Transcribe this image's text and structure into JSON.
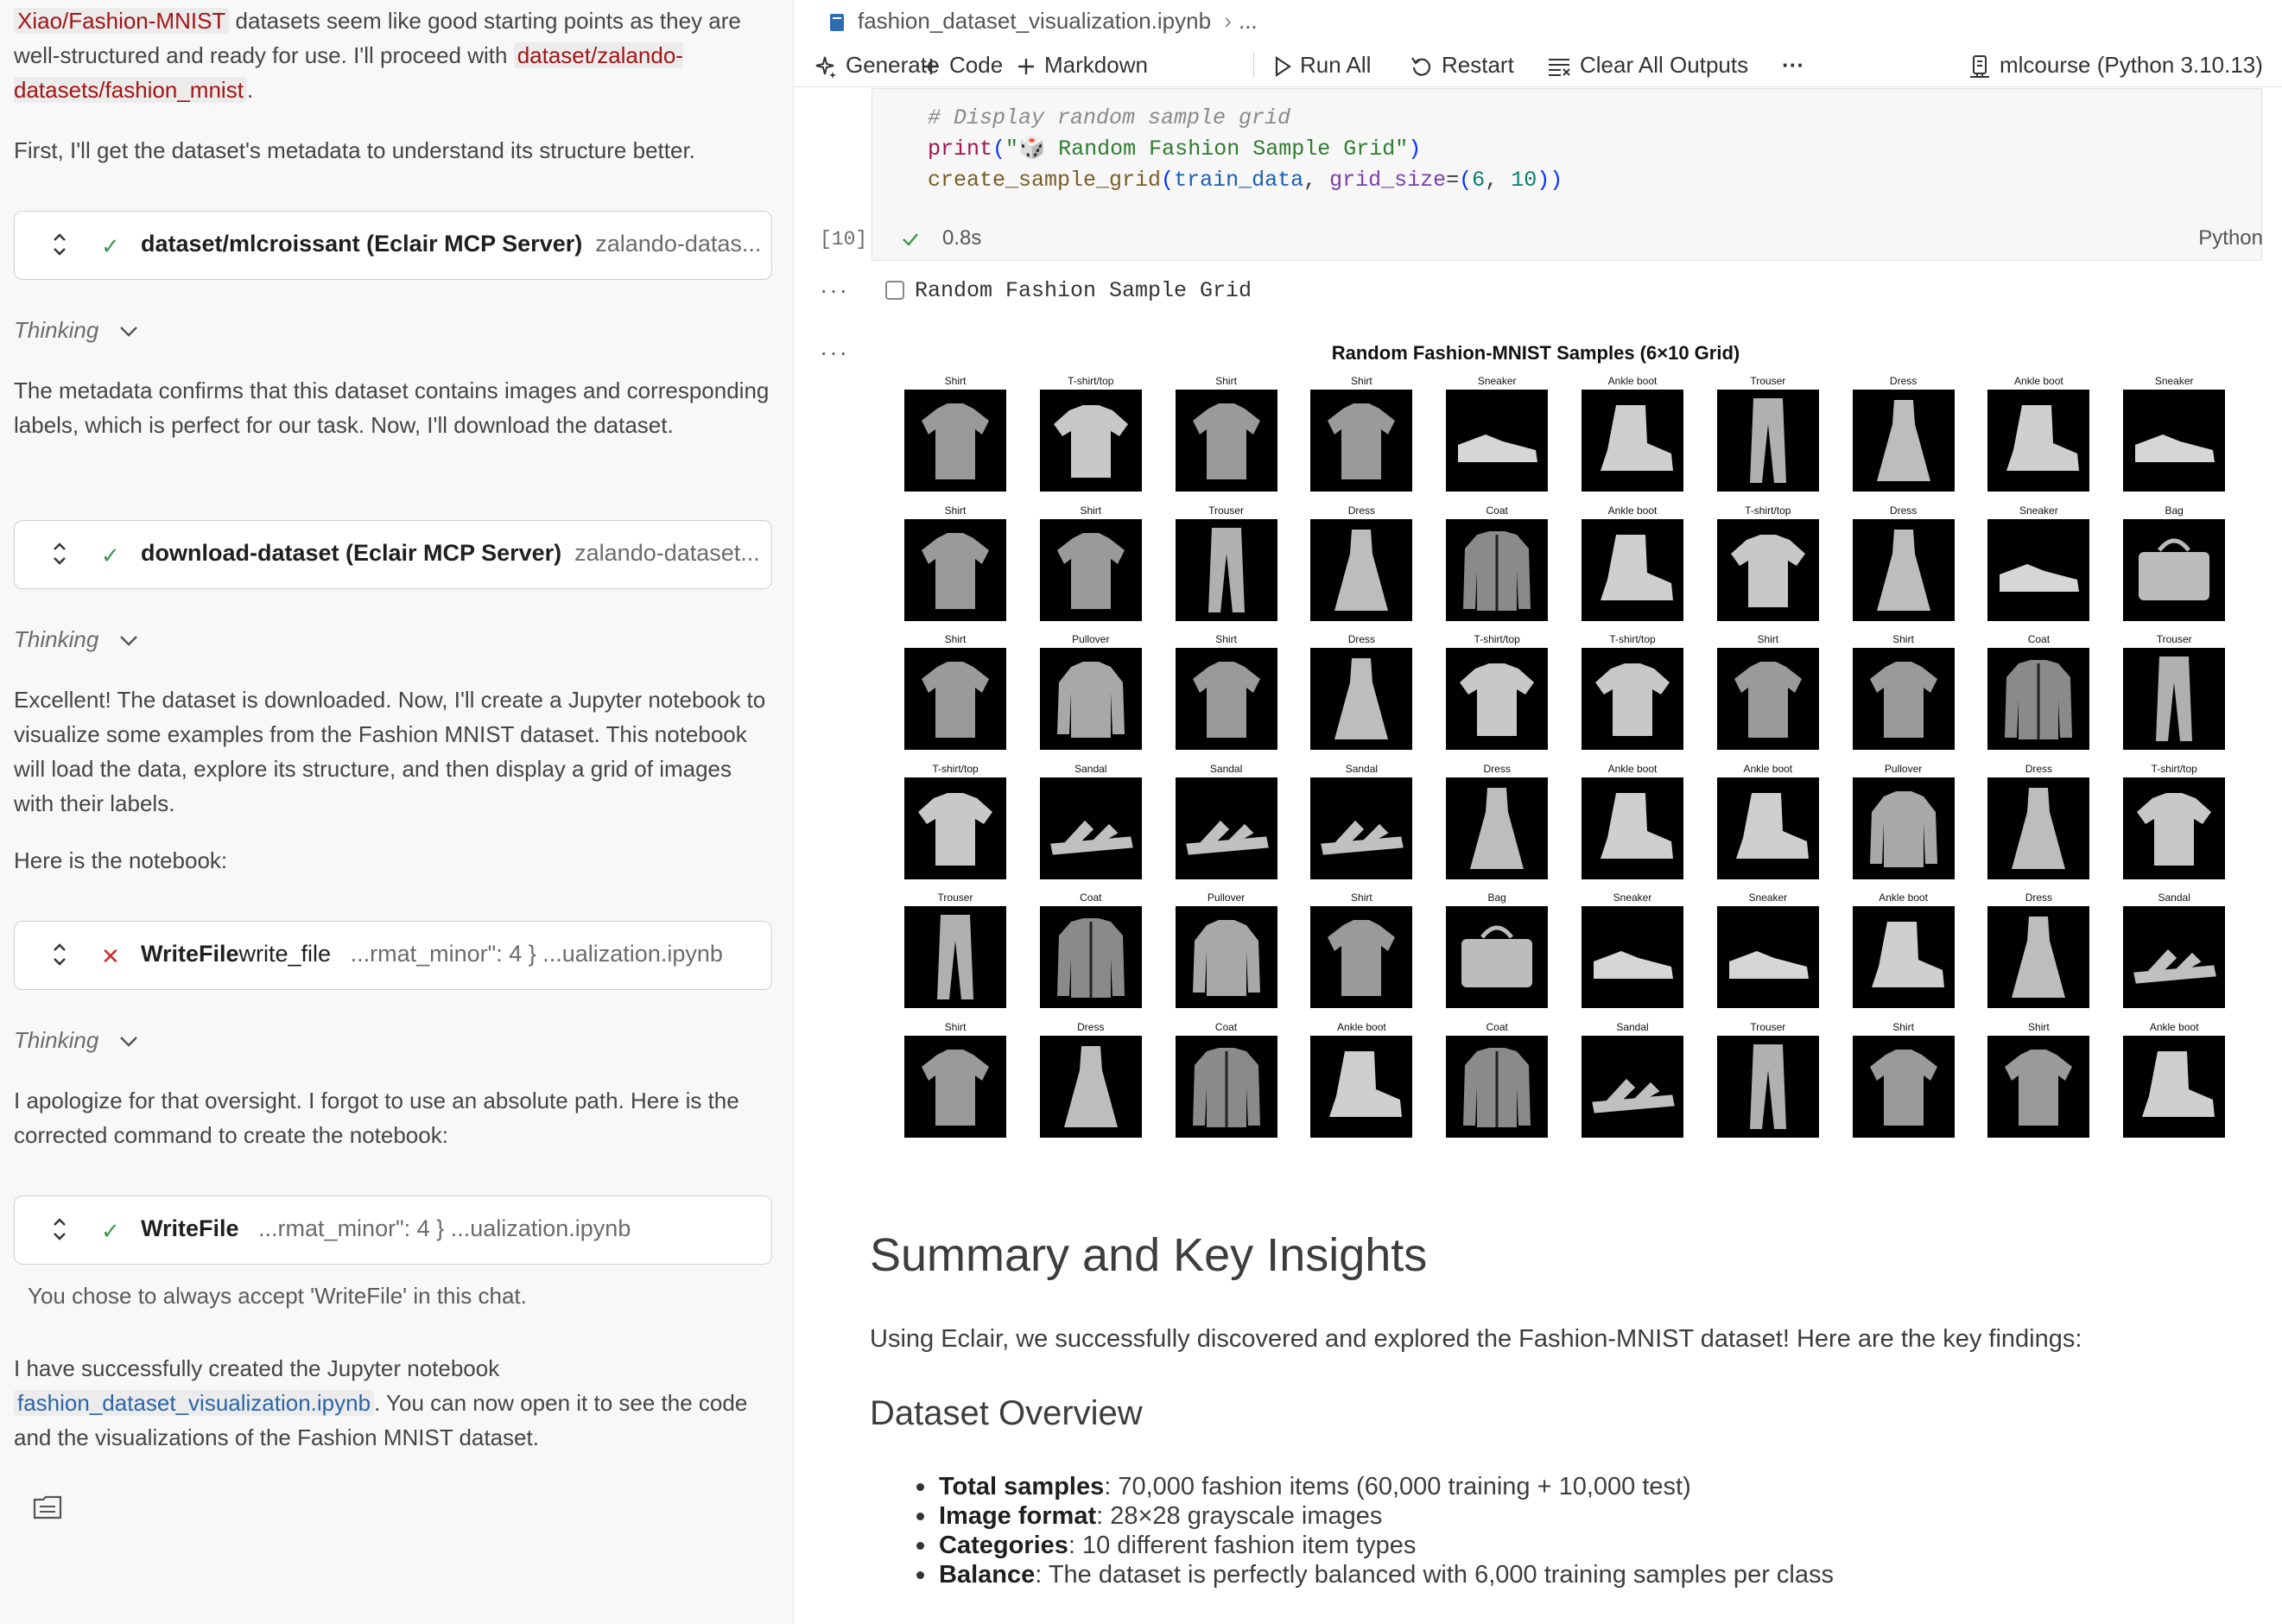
{
  "chat": {
    "intro_link1": "Xiao/Fashion-MNIST",
    "intro_text1": " datasets seem like good starting points as they are well-structured and ready for use. I'll proceed with ",
    "intro_link2": "dataset/zalando-datasets/fashion_mnist",
    "intro_text2": ".",
    "para_metadata_plan": "First, I'll get the dataset's metadata to understand its structure better.",
    "tool1": {
      "name": "dataset/mlcroissant (Eclair MCP Server)",
      "arg": "zalando-datas..."
    },
    "thinking_label": "Thinking",
    "para_metadata_result": "The metadata confirms that this dataset contains images and corresponding labels, which is perfect for our task. Now, I'll download the dataset.",
    "tool2": {
      "name": "download-dataset (Eclair MCP Server)",
      "arg": "zalando-dataset..."
    },
    "para_downloaded": "Excellent! The dataset is downloaded. Now, I'll create a Jupyter notebook to visualize some examples from the Fashion MNIST dataset. This notebook will load the data, explore its structure, and then display a grid of images with their labels.",
    "para_here": "Here is the notebook:",
    "tool3": {
      "name": "WriteFile",
      "name2": "write_file",
      "arg": "...rmat_minor\": 4 } ...ualization.ipynb"
    },
    "para_apology": "I apologize for that oversight. I forgot to use an absolute path. Here is the corrected command to create the notebook:",
    "tool4": {
      "name": "WriteFile",
      "arg": "...rmat_minor\": 4 } ...ualization.ipynb"
    },
    "accept_note": "You chose to always accept 'WriteFile' in this chat.",
    "final_text1": "I have successfully created the Jupyter notebook ",
    "final_link": "fashion_dataset_visualization.ipynb",
    "final_text2": ". You can now open it to see the code and the visualizations of the Fashion MNIST dataset."
  },
  "notebook": {
    "breadcrumb_file": "fashion_dataset_visualization.ipynb",
    "breadcrumb_more": "...",
    "toolbar": {
      "generate": "Generate",
      "code": "Code",
      "markdown": "Markdown",
      "run_all": "Run All",
      "restart": "Restart",
      "clear_outputs": "Clear All Outputs",
      "more": "···",
      "kernel": "mlcourse (Python 3.10.13)"
    },
    "cell": {
      "comment": "# Display random sample grid",
      "print_kw": "print",
      "print_arg": "\"🎲 Random Fashion Sample Grid\"",
      "call_fn": "create_sample_grid",
      "call_arg1": "train_data",
      "call_param": "grid_size",
      "call_n1": "6",
      "call_n2": "10",
      "exec_count": "[10]",
      "exec_time": "0.8s",
      "language": "Python"
    },
    "output_text": "Random Fashion Sample Grid",
    "output_dots": "···",
    "figure": {
      "title": "Random Fashion-MNIST Samples (6×10 Grid)",
      "labels": [
        [
          "Shirt",
          "T-shirt/top",
          "Shirt",
          "Shirt",
          "Sneaker",
          "Ankle boot",
          "Trouser",
          "Dress",
          "Ankle boot",
          "Sneaker"
        ],
        [
          "Shirt",
          "Shirt",
          "Trouser",
          "Dress",
          "Coat",
          "Ankle boot",
          "T-shirt/top",
          "Dress",
          "Sneaker",
          "Bag"
        ],
        [
          "Shirt",
          "Pullover",
          "Shirt",
          "Dress",
          "T-shirt/top",
          "T-shirt/top",
          "Shirt",
          "Shirt",
          "Coat",
          "Trouser"
        ],
        [
          "T-shirt/top",
          "Sandal",
          "Sandal",
          "Sandal",
          "Dress",
          "Ankle boot",
          "Ankle boot",
          "Pullover",
          "Dress",
          "T-shirt/top"
        ],
        [
          "Trouser",
          "Coat",
          "Pullover",
          "Shirt",
          "Bag",
          "Sneaker",
          "Sneaker",
          "Ankle boot",
          "Dress",
          "Sandal"
        ],
        [
          "Shirt",
          "Dress",
          "Coat",
          "Ankle boot",
          "Coat",
          "Sandal",
          "Trouser",
          "Shirt",
          "Shirt",
          "Ankle boot"
        ]
      ]
    },
    "markdown": {
      "title": "Summary and Key Insights",
      "intro": "Using Eclair, we successfully discovered and explored the Fashion-MNIST dataset! Here are the key findings:",
      "h2": "Dataset Overview",
      "items": [
        {
          "label": "Total samples",
          "text": ": 70,000 fashion items (60,000 training + 10,000 test)"
        },
        {
          "label": "Image format",
          "text": ": 28×28 grayscale images"
        },
        {
          "label": "Categories",
          "text": ": 10 different fashion item types"
        },
        {
          "label": "Balance",
          "text": ": The dataset is perfectly balanced with 6,000 training samples per class"
        }
      ]
    }
  },
  "colors": {
    "accent_ok": "#3a9a4a",
    "accent_err": "#cc2b2b",
    "chip_text": "#a31515",
    "link": "#2b65a8"
  }
}
